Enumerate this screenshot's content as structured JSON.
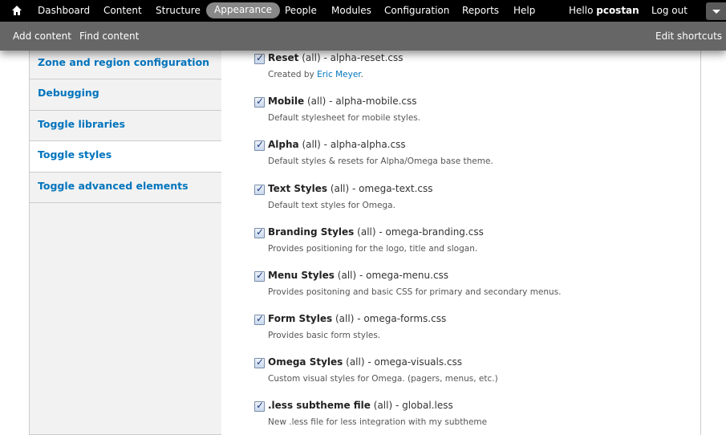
{
  "toolbar": {
    "items": [
      "Dashboard",
      "Content",
      "Structure",
      "Appearance",
      "People",
      "Modules",
      "Configuration",
      "Reports",
      "Help"
    ],
    "active_item": "Appearance",
    "hello_prefix": "Hello ",
    "username": "pcostan",
    "logout": "Log out"
  },
  "shortcuts": {
    "add_content": "Add content",
    "find_content": "Find content",
    "edit_shortcuts": "Edit shortcuts"
  },
  "vertical_tabs": [
    {
      "label": "Zone and region configuration",
      "selected": false
    },
    {
      "label": "Debugging",
      "selected": false
    },
    {
      "label": "Toggle libraries",
      "selected": false
    },
    {
      "label": "Toggle styles",
      "selected": true
    },
    {
      "label": "Toggle advanced elements",
      "selected": false
    }
  ],
  "styles": [
    {
      "name": "Reset",
      "media": "(all)",
      "file": "alpha-reset.css",
      "checked": true,
      "desc_prefix": "Created by ",
      "desc_link": "Eric Meyer",
      "desc_suffix": "."
    },
    {
      "name": "Mobile",
      "media": "(all)",
      "file": "alpha-mobile.css",
      "checked": true,
      "desc": "Default stylesheet for mobile styles."
    },
    {
      "name": "Alpha",
      "media": "(all)",
      "file": "alpha-alpha.css",
      "checked": true,
      "desc": "Default styles & resets for Alpha/Omega base theme."
    },
    {
      "name": "Text Styles",
      "media": "(all)",
      "file": "omega-text.css",
      "checked": true,
      "desc": "Default text styles for Omega."
    },
    {
      "name": "Branding Styles",
      "media": "(all)",
      "file": "omega-branding.css",
      "checked": true,
      "desc": "Provides positioning for the logo, title and slogan."
    },
    {
      "name": "Menu Styles",
      "media": "(all)",
      "file": "omega-menu.css",
      "checked": true,
      "desc": "Provides positoning and basic CSS for primary and secondary menus."
    },
    {
      "name": "Form Styles",
      "media": "(all)",
      "file": "omega-forms.css",
      "checked": true,
      "desc": "Provides basic form styles."
    },
    {
      "name": "Omega Styles",
      "media": "(all)",
      "file": "omega-visuals.css",
      "checked": true,
      "desc": "Custom visual styles for Omega. (pagers, menus, etc.)"
    },
    {
      "name": ".less subtheme file",
      "media": "(all)",
      "file": "global.less",
      "checked": true,
      "desc": "New .less file for less integration with my subtheme"
    }
  ],
  "separator": " - ",
  "colors": {
    "link": "#0074bd",
    "toolbar": "#000000",
    "shortcuts": "#666666"
  },
  "icons": {
    "home": "home-icon",
    "toggle": "chevron-down-icon"
  }
}
